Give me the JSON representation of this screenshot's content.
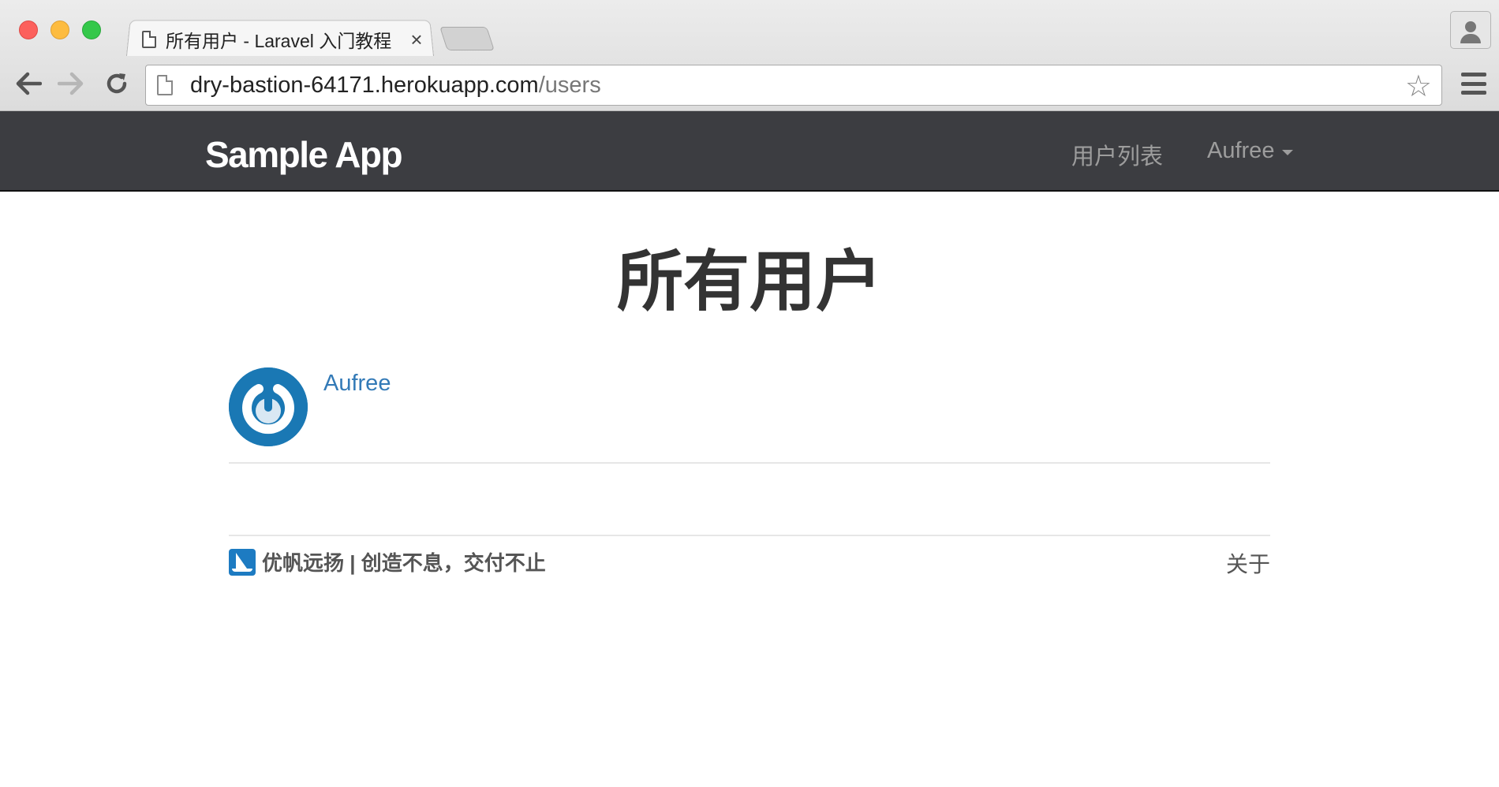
{
  "browser": {
    "tab_title": "所有用户 - Laravel 入门教程",
    "tab_close": "×",
    "url_host": "dry-bastion-64171.herokuapp.com",
    "url_path": "/users",
    "icons": [
      "back-arrow-icon",
      "forward-arrow-icon",
      "reload-icon",
      "page-icon",
      "star-icon",
      "menu-icon",
      "profile-icon"
    ]
  },
  "navbar": {
    "brand": "Sample App",
    "users_link": "用户列表",
    "account_label": "Aufree"
  },
  "main": {
    "title": "所有用户",
    "users": [
      {
        "name": "Aufree"
      }
    ]
  },
  "footer": {
    "brand": "优帆远扬 | 创造不息，交付不止",
    "about": "关于"
  },
  "colors": {
    "navbar_bg": "#3c3d41",
    "link": "#337ab7",
    "avatar": "#1a78b4"
  }
}
